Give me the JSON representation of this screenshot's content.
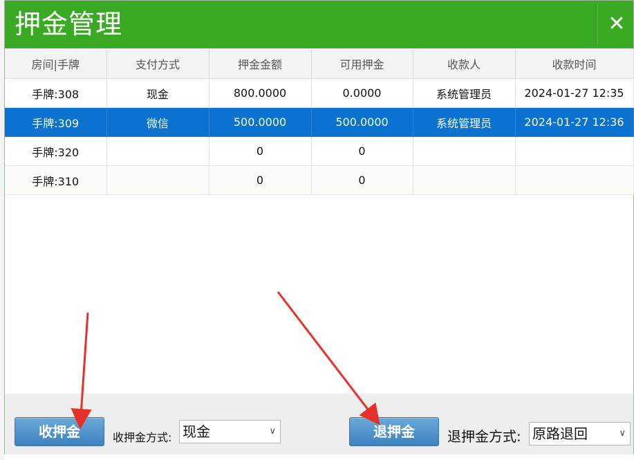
{
  "dialog": {
    "title": "押金管理",
    "close_glyph": "✕"
  },
  "table": {
    "headers": [
      "房间|手牌",
      "支付方式",
      "押金金额",
      "可用押金",
      "收款人",
      "收款时间"
    ],
    "rows": [
      [
        "手牌:308",
        "现金",
        "800.0000",
        "0.0000",
        "系统管理员",
        "2024-01-27 12:35"
      ],
      [
        "手牌:309",
        "微信",
        "500.0000",
        "500.0000",
        "系统管理员",
        "2024-01-27 12:36"
      ],
      [
        "手牌:320",
        "",
        "0",
        "0",
        "",
        ""
      ],
      [
        "手牌:310",
        "",
        "0",
        "0",
        "",
        ""
      ]
    ],
    "selected_row": 1
  },
  "footer": {
    "collect_button": "收押金",
    "collect_method_label": "收押金方式:",
    "collect_method_value": "现金",
    "refund_button": "退押金",
    "refund_method_label": "退押金方式:",
    "refund_method_value": "原路退回"
  },
  "colors": {
    "titlebar": "#3aaa24",
    "selected_row": "#0b72cf",
    "button": "#4a8fc8",
    "annotation_arrow": "#e8302a"
  }
}
